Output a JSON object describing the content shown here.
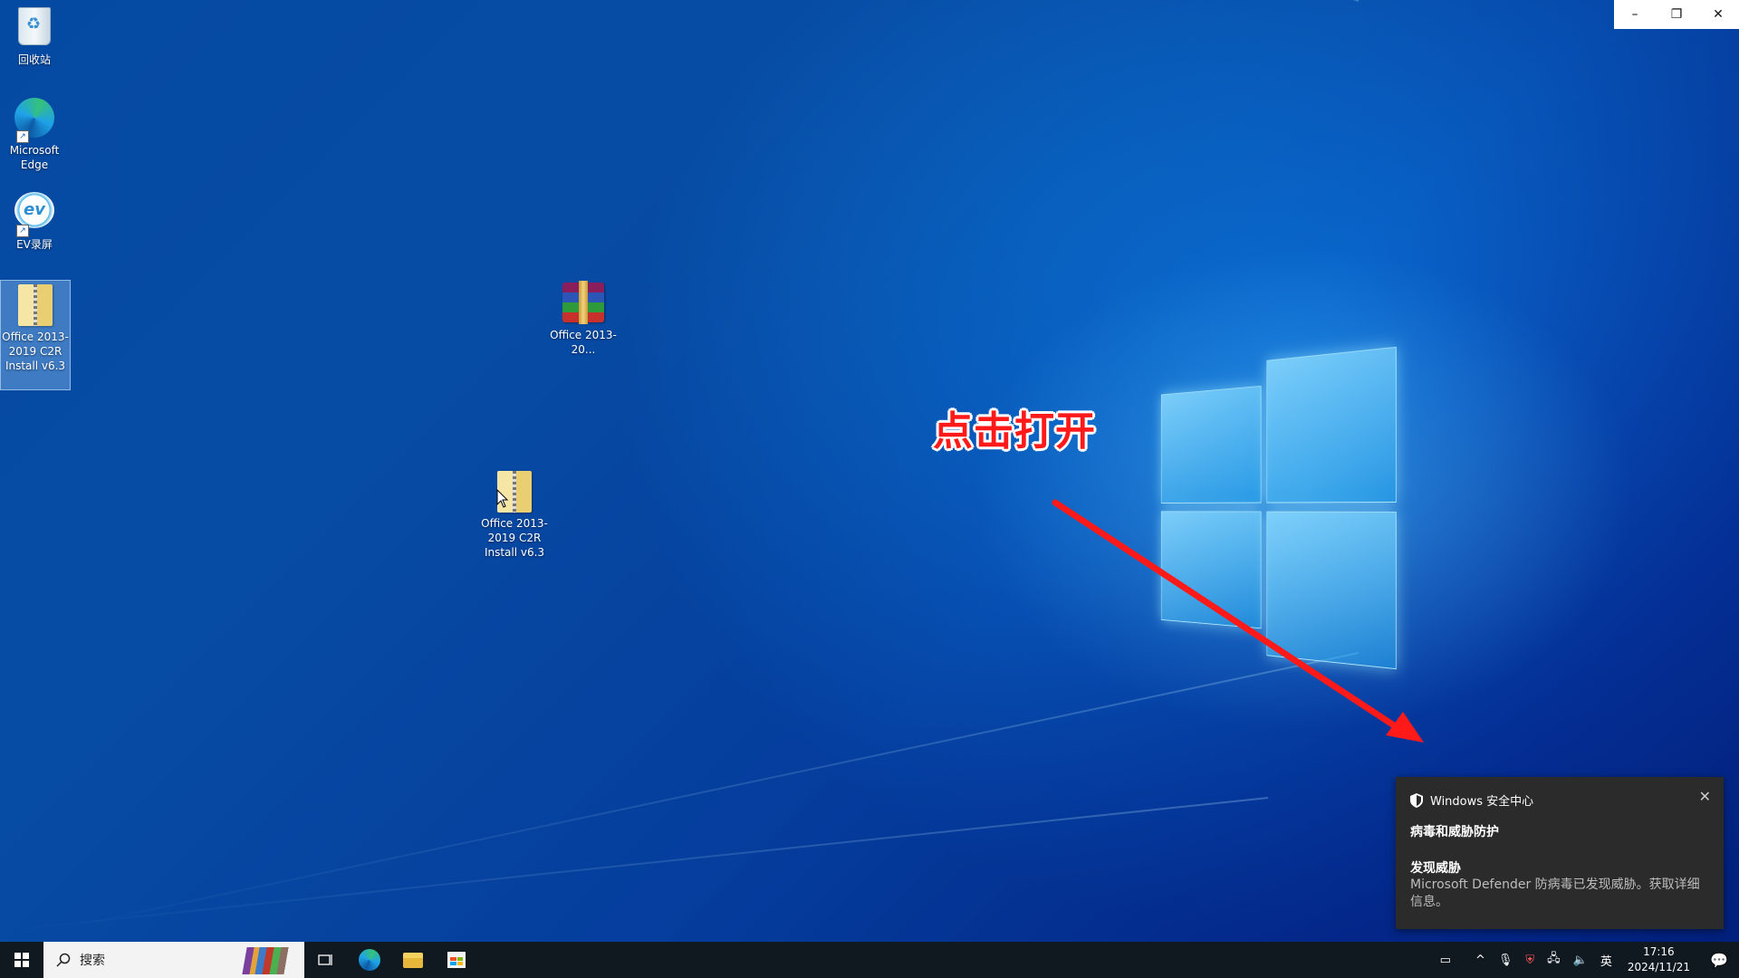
{
  "window_controls": {
    "minimize": "–",
    "restore": "❐",
    "close": "✕"
  },
  "desktop_icons": [
    {
      "label": "回收站",
      "icon": "recycle-bin-icon"
    },
    {
      "label": "Microsoft Edge",
      "icon": "edge-icon"
    },
    {
      "label": "EV录屏",
      "icon": "ev-recorder-icon"
    },
    {
      "label": "Office 2013-2019 C2R Install v6.3",
      "icon": "zip-folder-icon"
    },
    {
      "label": "Office 2013-20...",
      "icon": "winrar-archive-icon"
    },
    {
      "label": "Office 2013-2019 C2R Install v6.3",
      "icon": "zip-folder-icon"
    }
  ],
  "annotation": {
    "text": "点击打开",
    "color": "#ff1a1a"
  },
  "toast": {
    "app": "Windows 安全中心",
    "title": "病毒和威胁防护",
    "heading": "发现威胁",
    "body": "Microsoft Defender 防病毒已发现威胁。获取详细信息。",
    "close": "✕"
  },
  "taskbar": {
    "search_placeholder": "搜索",
    "tray": {
      "ime": "英",
      "time": "17:16",
      "date": "2024/11/21"
    }
  }
}
